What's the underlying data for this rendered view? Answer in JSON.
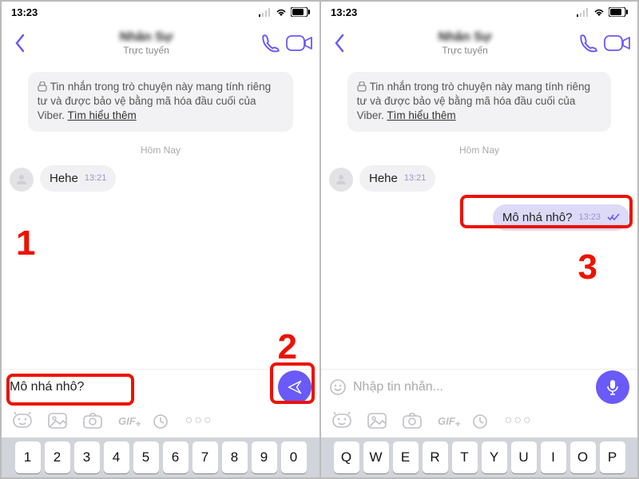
{
  "left": {
    "status": {
      "time": "13:23"
    },
    "header": {
      "name": "Nhân Sự",
      "status": "Trực tuyến"
    },
    "notice": {
      "text_prefix": "Tin nhắn trong trò chuyện này mang tính riêng tư và được bảo vệ bằng mã hóa đầu cuối của Viber. ",
      "learn": "Tìm hiểu thêm"
    },
    "date_sep": "Hôm Nay",
    "in_msg": {
      "text": "Hehe",
      "time": "13:21"
    },
    "draft": "Mô nhá nhô?",
    "keys": [
      "1",
      "2",
      "3",
      "4",
      "5",
      "6",
      "7",
      "8",
      "9",
      "0"
    ],
    "callouts": {
      "one": "1",
      "two": "2"
    }
  },
  "right": {
    "status": {
      "time": "13:23"
    },
    "header": {
      "name": "Nhân Sự",
      "status": "Trực tuyến"
    },
    "notice": {
      "text_prefix": "Tin nhắn trong trò chuyện này mang tính riêng tư và được bảo vệ bằng mã hóa đầu cuối của Viber. ",
      "learn": "Tìm hiểu thêm"
    },
    "date_sep": "Hôm Nay",
    "in_msg": {
      "text": "Hehe",
      "time": "13:21"
    },
    "out_msg": {
      "text": "Mô nhá nhô?",
      "time": "13:23"
    },
    "placeholder": "Nhập tin nhắn...",
    "keys": [
      "Q",
      "W",
      "E",
      "R",
      "T",
      "Y",
      "U",
      "I",
      "O",
      "P"
    ],
    "callouts": {
      "three": "3"
    }
  },
  "icons": {
    "sticker": "sticker-icon",
    "gallery": "gallery-icon",
    "camera": "camera-icon",
    "gif": "gif-icon",
    "timer": "timer-icon",
    "more": "more-icon"
  }
}
